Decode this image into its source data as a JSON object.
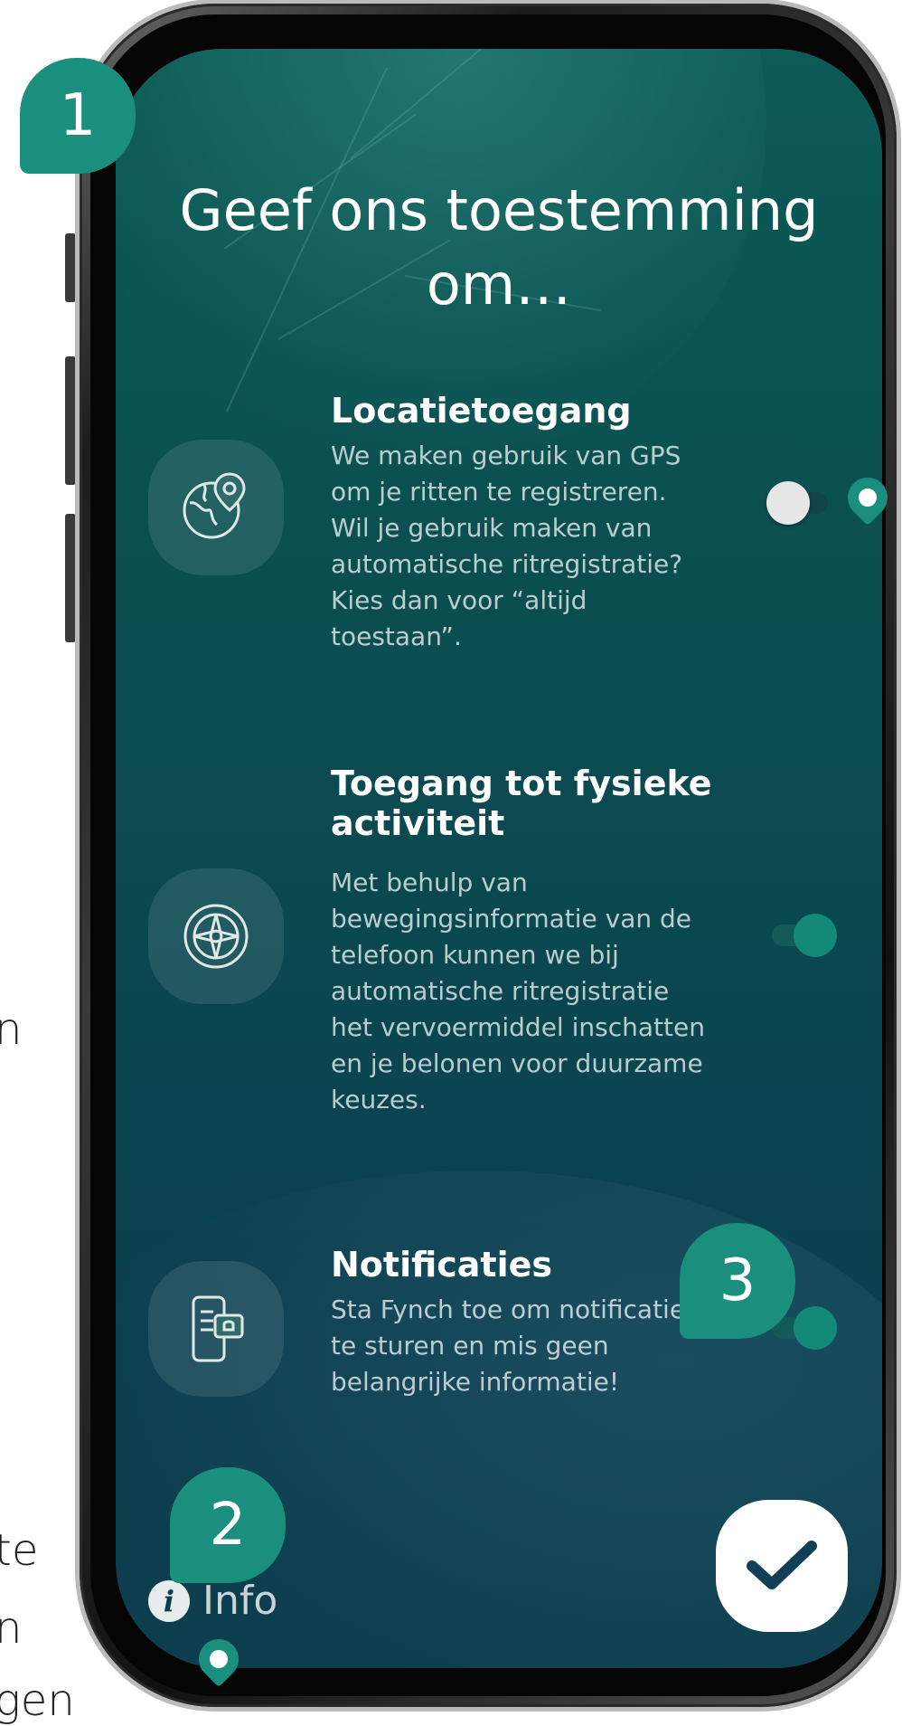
{
  "page": {
    "title": "Geef ons toestemming om…",
    "permissions": [
      {
        "title": "Locatietoegang",
        "description": "We maken gebruik van GPS om je ritten te registreren. Wil je gebruik maken van automatische ritregistratie? Kies dan voor “altijd toestaan”.",
        "icon": "globe-location-pin-icon",
        "enabled": false
      },
      {
        "title": "Toegang tot fysieke activiteit",
        "description": "Met behulp van bewegingsinformatie van de telefoon kunnen we bij automatische ritregistratie het vervoermiddel inschatten en je belonen voor duurzame keuzes.",
        "icon": "compass-icon",
        "enabled": true
      },
      {
        "title": "Notificaties",
        "description": "Sta Fynch toe om notificaties te sturen en mis geen belangrijke informatie!",
        "icon": "phone-notification-icon",
        "enabled": true
      }
    ],
    "info_label": "Info",
    "confirm_icon": "checkmark-icon"
  },
  "annotations": {
    "badge_1": "1",
    "badge_2": "2",
    "badge_3": "3"
  },
  "edge_text": [
    "n",
    "te",
    "n",
    "gen"
  ],
  "colors": {
    "accent": "#1b8f7e",
    "screen_bg": "#0b4f50",
    "toggle_on": "#13897a",
    "toggle_off_knob": "#e6e6e6"
  }
}
